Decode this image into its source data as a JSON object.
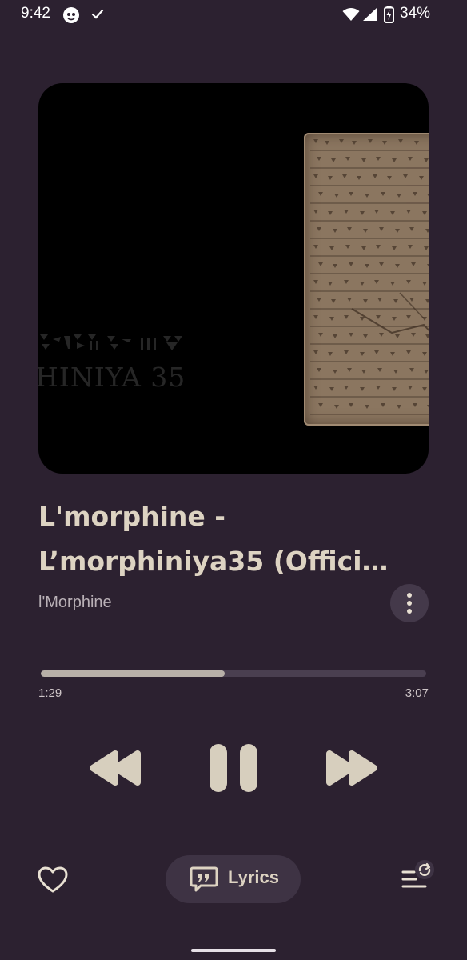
{
  "status_bar": {
    "time": "9:42",
    "battery": "34%",
    "icons": [
      "app-notification-icon",
      "check-icon",
      "wifi-icon",
      "cellular-signal-icon",
      "battery-charging-icon"
    ]
  },
  "album_art": {
    "caption": "HINIYA 35",
    "cuneiform_text": "⹂⹂⹂⹂ ⹂⹂⹂"
  },
  "track": {
    "title_line1": "L'morphine -",
    "title_line2": "L’morphiniya35 (Offici…",
    "artist": "l'Morphine"
  },
  "progress": {
    "elapsed": "1:29",
    "total": "3:07",
    "fraction": 0.477
  },
  "controls": {
    "rewind_icon": "rewind-icon",
    "pause_icon": "pause-icon",
    "fast_forward_icon": "fast-forward-icon"
  },
  "bottom_bar": {
    "like_icon": "heart-outline-icon",
    "lyrics_label": "Lyrics",
    "lyrics_icon": "lyrics-icon",
    "queue_icon": "queue-icon"
  },
  "colors": {
    "background": "#2c2130",
    "title": "#ddd3c2",
    "accent_controls": "#d7cfbe",
    "progress_fill": "#b8b0a8"
  }
}
